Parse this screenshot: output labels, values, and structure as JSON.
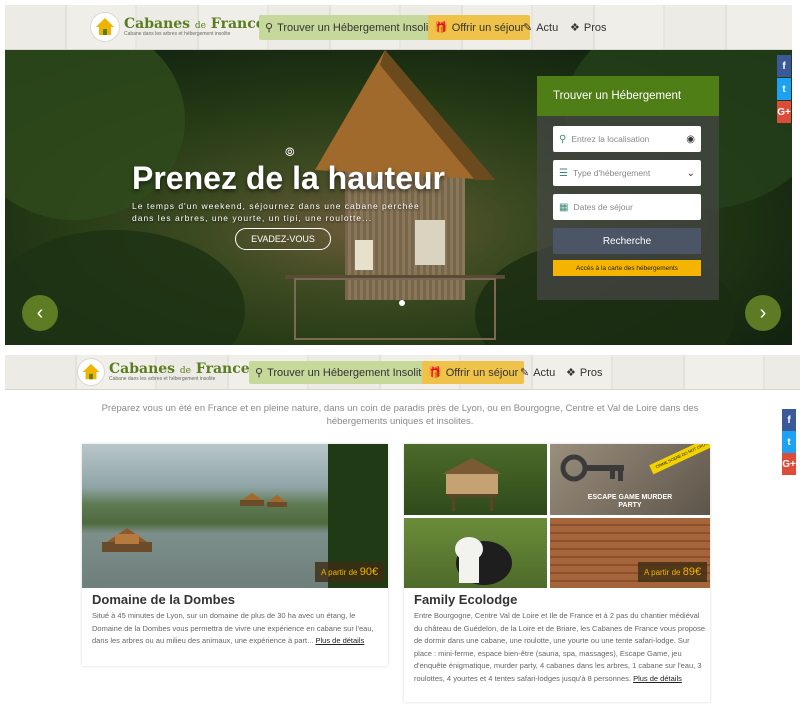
{
  "brand": {
    "name": "Cabanes",
    "name_suffix": "de",
    "name_end": "France",
    "tagline": "Cabane dans les arbres et hébergement insolite"
  },
  "nav": {
    "find_label": "Trouver un Hébergement Insolite",
    "gift_label": "Offrir un séjour",
    "news_label": "Actu",
    "pros_label": "Pros"
  },
  "hero": {
    "title": "Prenez de la hauteur",
    "subtitle": "Le temps d'un weekend, séjournez dans une cabane perchée dans les arbres, une yourte, un tipi, une roulotte...",
    "cta": "EVADEZ-VOUS"
  },
  "search": {
    "title": "Trouver un Hébergement",
    "location_placeholder": "Entrez la localisation",
    "type_placeholder": "Type d'hébergement",
    "dates_placeholder": "Dates de séjour",
    "search_button": "Recherche",
    "map_button": "Accès à la carte des hébergements"
  },
  "social": {
    "facebook": "f",
    "twitter": "t",
    "google": "G+"
  },
  "intro": "Préparez vous un été en France et en pleine nature, dans un coin de paradis près de Lyon, ou en Bourgogne, Centre et Val de Loire dans des hébergements uniques et insolites.",
  "cards": [
    {
      "title": "Domaine de la Dombes",
      "price_prefix": "A partir de",
      "price": "90€",
      "text": "Situé à 45 minutes de Lyon, sur un domaine de plus de 30 ha avec un étang, le Domaine de la Dombes vous permettra de vivre une expérience en cabane sur l'eau, dans les arbres ou au milieu des animaux, une expérience à part...",
      "more": "Plus de détails"
    },
    {
      "title": "Family Ecolodge",
      "price_prefix": "A partir de",
      "price": "89€",
      "escape_sign": "ESCAPE GAME MURDER PARTY",
      "crime_tape": "CRIME SCENE DO NOT CROSS",
      "text": "Entre Bourgogne, Centre Val de Loire et Ile de France et à 2 pas du chantier médiéval du château de Guédelon, de la Loire et de Briare, les Cabanes de France vous propose de dormir dans une cabane, une roulotte, une yourte ou une tente safari-lodge. Sur place : mini-ferme, espace bien-être (sauna, spa, massages), Escape Game, jeu d'enquête énigmatique, murder party, 4 cabanes dans les arbres, 1 cabane sur l'eau, 3 roulottes, 4 yourtes et 4 tentes safari-lodges jusqu'à 8 personnes.",
      "more": "Plus de détails"
    }
  ],
  "colors": {
    "green": "#4f7d16",
    "gold": "#efc24a",
    "navy": "#4b5566",
    "yellow": "#f5b400"
  }
}
